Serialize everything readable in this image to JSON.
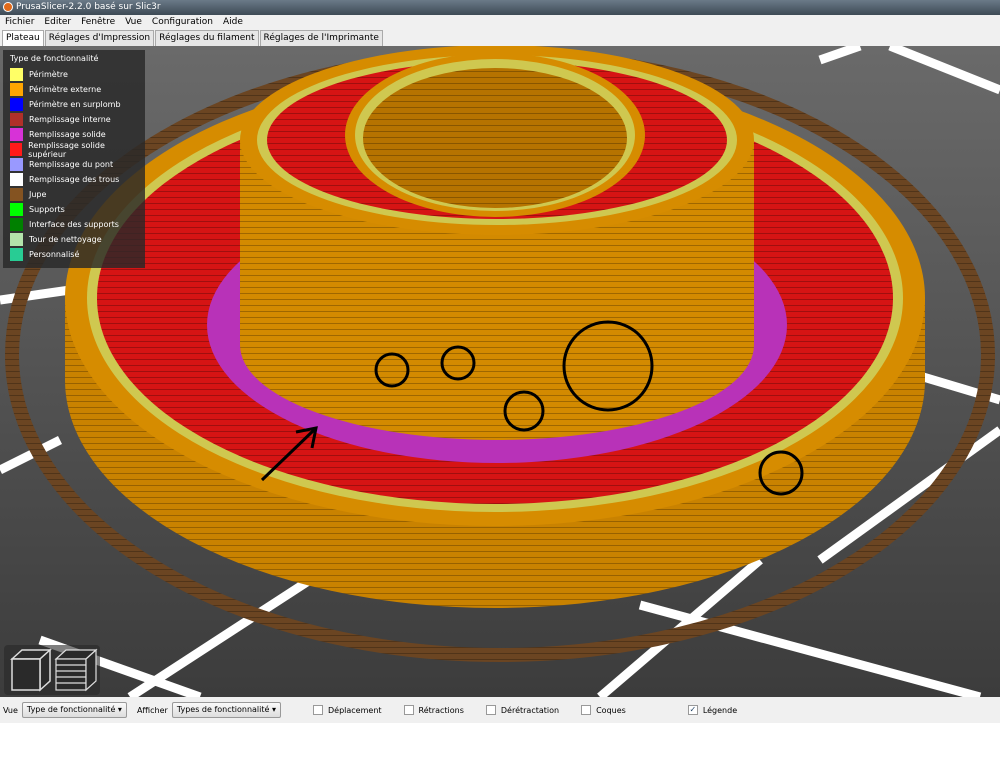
{
  "window": {
    "title": "PrusaSlicer-2.2.0 basé sur Slic3r"
  },
  "menu": [
    "Fichier",
    "Editer",
    "Fenêtre",
    "Vue",
    "Configuration",
    "Aide"
  ],
  "tabs": [
    "Plateau",
    "Réglages d'Impression",
    "Réglages du filament",
    "Réglages de l'Imprimante"
  ],
  "legend": {
    "title": "Type de fonctionnalité",
    "items": [
      {
        "label": "Périmètre",
        "color": "#ffff66"
      },
      {
        "label": "Périmètre externe",
        "color": "#ffa500"
      },
      {
        "label": "Périmètre en surplomb",
        "color": "#0000ff"
      },
      {
        "label": "Remplissage interne",
        "color": "#b03029"
      },
      {
        "label": "Remplissage solide",
        "color": "#d732d7"
      },
      {
        "label": "Remplissage solide supérieur",
        "color": "#ff1a1a"
      },
      {
        "label": "Remplissage du pont",
        "color": "#9999ff"
      },
      {
        "label": "Remplissage des trous",
        "color": "#ffffff"
      },
      {
        "label": "Jupe",
        "color": "#845321"
      },
      {
        "label": "Supports",
        "color": "#00ff00"
      },
      {
        "label": "Interface des supports",
        "color": "#008000"
      },
      {
        "label": "Tour de nettoyage",
        "color": "#b3e3ab"
      },
      {
        "label": "Personnalisé",
        "color": "#28cc94"
      }
    ]
  },
  "bottom": {
    "vue_label": "Vue",
    "vue_value": "Type de fonctionnalité",
    "afficher_label": "Afficher",
    "afficher_value": "Types de fonctionnalité",
    "checks": [
      {
        "label": "Déplacement",
        "checked": false
      },
      {
        "label": "Rétractions",
        "checked": false
      },
      {
        "label": "Dérétractation",
        "checked": false
      },
      {
        "label": "Coques",
        "checked": false
      },
      {
        "label": "Légende",
        "checked": true
      }
    ]
  }
}
